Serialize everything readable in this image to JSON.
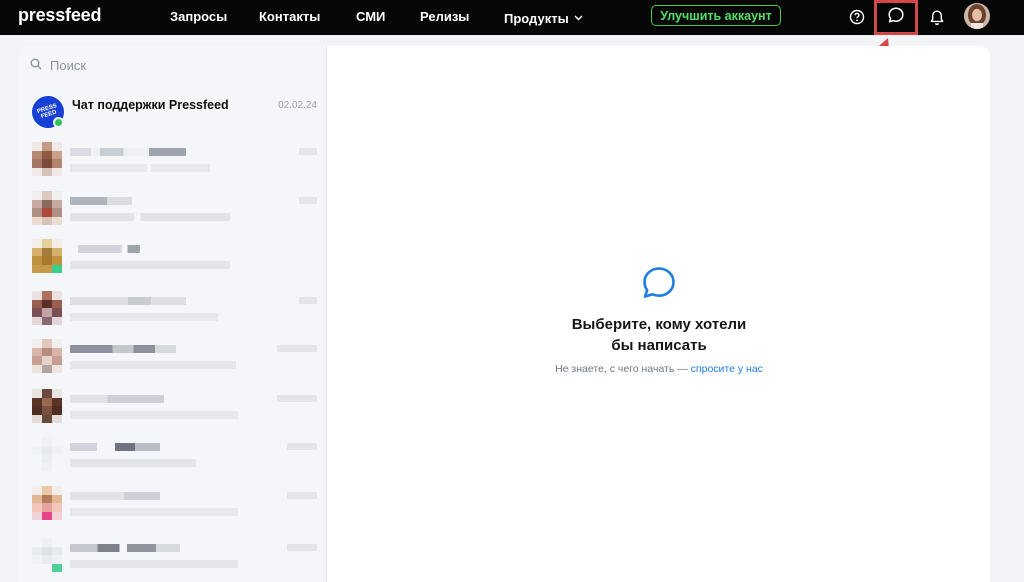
{
  "header": {
    "logo": "pressfeed",
    "nav": [
      "Запросы",
      "Контакты",
      "СМИ",
      "Релизы",
      "Продукты"
    ],
    "upgrade_label": "Улучшить аккаунт",
    "icons": [
      "help-icon",
      "chat-icon",
      "bell-icon"
    ]
  },
  "sidebar": {
    "search_placeholder": "Поиск",
    "support_chat": {
      "name": "Чат поддержки Pressfeed",
      "date": "02.02.24",
      "avatar_text": "PRESS FEED"
    }
  },
  "empty_state": {
    "title_line1": "Выберите, кому хотели",
    "title_line2": "бы написать",
    "hint_prefix": "Не знаете, с чего начать —",
    "hint_link": "спросите у нас"
  },
  "colors": {
    "topbar": "#060606",
    "upgrade_accent": "#3dcb4f",
    "highlight": "#d24848",
    "link": "#1f7ce0"
  }
}
